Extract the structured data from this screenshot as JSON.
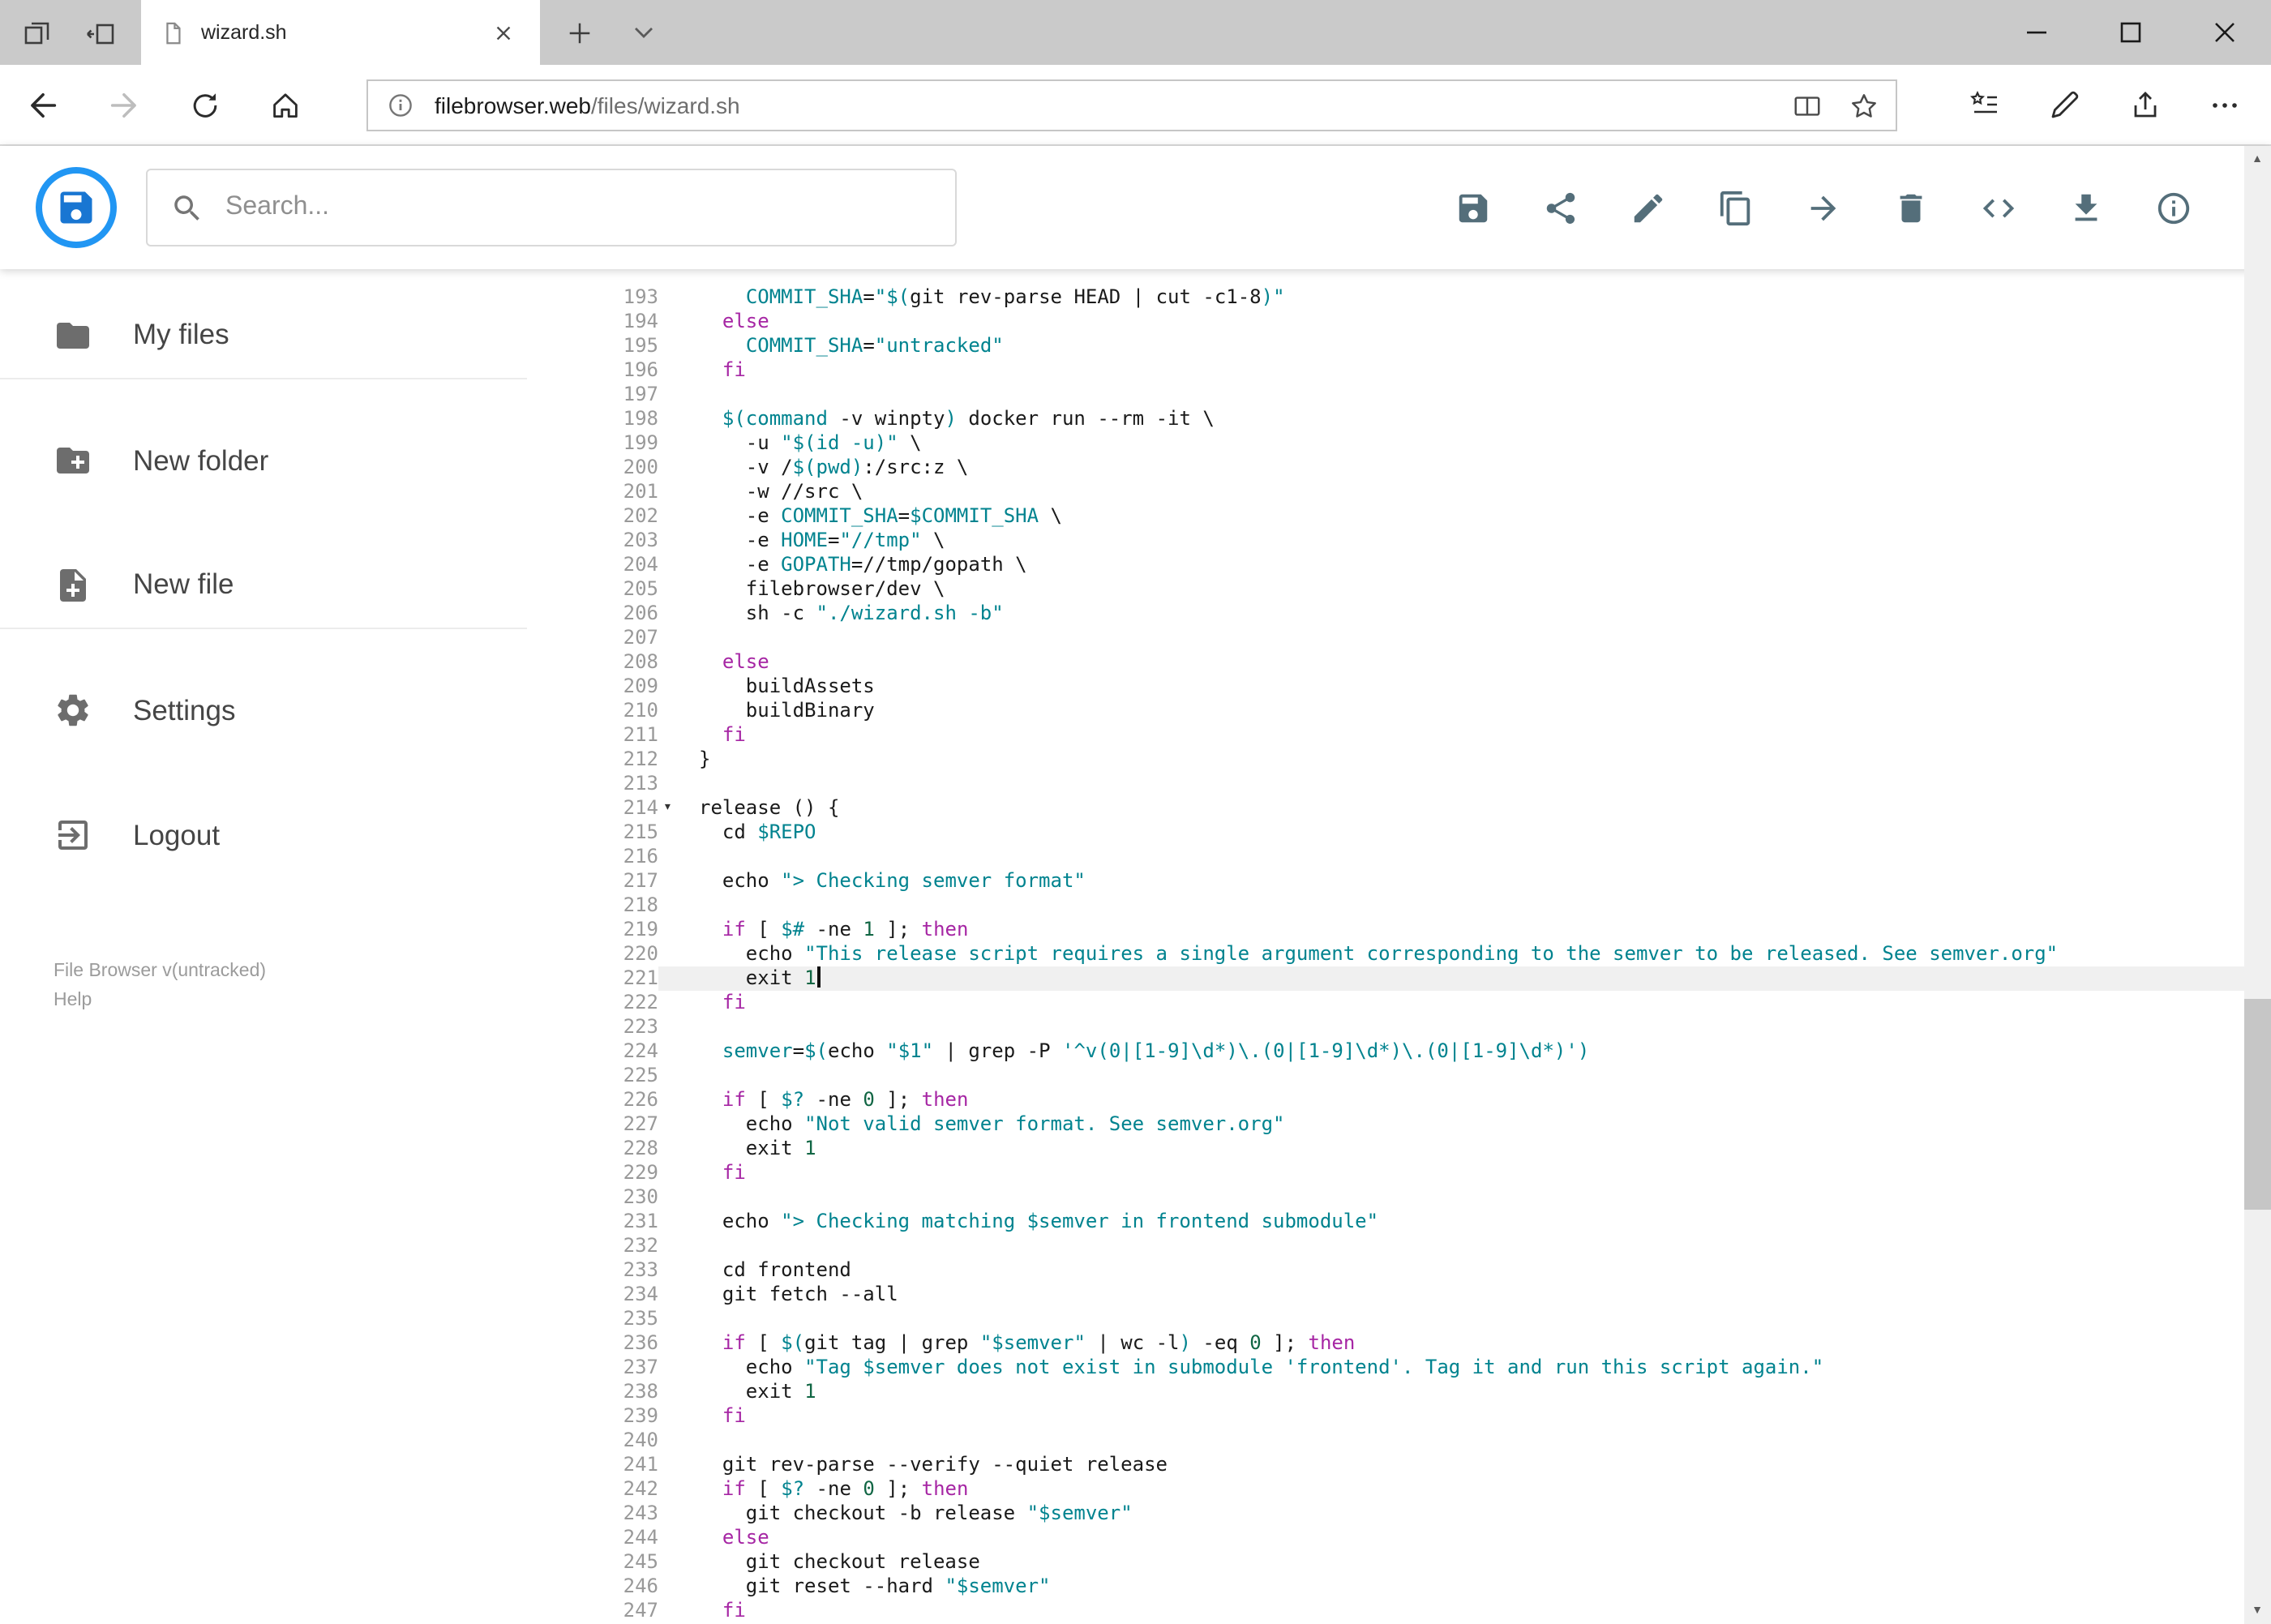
{
  "browser": {
    "tab_title": "wizard.sh",
    "url_domain": "filebrowser.web",
    "url_path": "/files/wizard.sh",
    "tabbar_icons": [
      "tabs-aside-list",
      "set-tabs-aside",
      "new-tab",
      "tab-preview-chevron"
    ],
    "nav_icons": [
      "back",
      "forward",
      "refresh",
      "home"
    ],
    "urlbar_icons": [
      "site-info",
      "reading-view",
      "favorite-star"
    ],
    "toolbar_icons": [
      "hub",
      "web-note",
      "share",
      "more"
    ],
    "window_controls": [
      "minimize",
      "maximize",
      "close"
    ]
  },
  "header": {
    "search_placeholder": "Search...",
    "logo_color": "#2196f3",
    "icon_color": "#546e7a",
    "actions": [
      {
        "id": "save",
        "icon": "save"
      },
      {
        "id": "share",
        "icon": "share"
      },
      {
        "id": "edit",
        "icon": "edit"
      },
      {
        "id": "copy",
        "icon": "copy"
      },
      {
        "id": "move",
        "icon": "move"
      },
      {
        "id": "delete",
        "icon": "delete"
      },
      {
        "id": "code",
        "icon": "code"
      },
      {
        "id": "download",
        "icon": "download"
      },
      {
        "id": "info",
        "icon": "info"
      }
    ]
  },
  "sidebar": {
    "items": [
      {
        "id": "my-files",
        "icon": "folder",
        "label": "My files",
        "divider": true
      },
      {
        "id": "new-folder",
        "icon": "create-new-folder",
        "label": "New folder",
        "divider": false
      },
      {
        "id": "new-file",
        "icon": "new-file",
        "label": "New file",
        "divider": true
      },
      {
        "id": "settings",
        "icon": "settings",
        "label": "Settings",
        "divider": false
      },
      {
        "id": "logout",
        "icon": "logout",
        "label": "Logout",
        "divider": false
      }
    ],
    "footer_version": "File Browser v(untracked)",
    "footer_help": "Help"
  },
  "editor": {
    "syntax_colors": {
      "plain": "#1a1a1a",
      "keyword": "#a626a4",
      "string_var": "#00838f",
      "number": "#116644",
      "line_number": "#999999",
      "active_line_bg": "#f0f0f0"
    },
    "lines": [
      {
        "n": 193,
        "t": [
          [
            "p",
            "    "
          ],
          [
            "t",
            "COMMIT_SHA"
          ],
          [
            "p",
            "="
          ],
          [
            "t",
            "\"$("
          ],
          [
            "p",
            "git rev-parse HEAD | cut -c1-8"
          ],
          [
            "t",
            ")\""
          ]
        ]
      },
      {
        "n": 194,
        "t": [
          [
            "p",
            "  "
          ],
          [
            "k",
            "else"
          ]
        ]
      },
      {
        "n": 195,
        "t": [
          [
            "p",
            "    "
          ],
          [
            "t",
            "COMMIT_SHA"
          ],
          [
            "p",
            "="
          ],
          [
            "t",
            "\"untracked\""
          ]
        ]
      },
      {
        "n": 196,
        "t": [
          [
            "p",
            "  "
          ],
          [
            "k",
            "fi"
          ]
        ]
      },
      {
        "n": 197,
        "t": []
      },
      {
        "n": 198,
        "t": [
          [
            "p",
            "  "
          ],
          [
            "t",
            "$(command"
          ],
          [
            "p",
            " -v winpty"
          ],
          [
            "t",
            ")"
          ],
          [
            "p",
            " docker run --rm -it \\"
          ]
        ]
      },
      {
        "n": 199,
        "t": [
          [
            "p",
            "    -u "
          ],
          [
            "t",
            "\"$(id -u)\""
          ],
          [
            "p",
            " \\"
          ]
        ]
      },
      {
        "n": 200,
        "t": [
          [
            "p",
            "    -v /"
          ],
          [
            "t",
            "$(pwd)"
          ],
          [
            "p",
            ":/src:z \\"
          ]
        ]
      },
      {
        "n": 201,
        "t": [
          [
            "p",
            "    -w //src \\"
          ]
        ]
      },
      {
        "n": 202,
        "t": [
          [
            "p",
            "    -e "
          ],
          [
            "t",
            "COMMIT_SHA"
          ],
          [
            "p",
            "="
          ],
          [
            "t",
            "$COMMIT_SHA"
          ],
          [
            "p",
            " \\"
          ]
        ]
      },
      {
        "n": 203,
        "t": [
          [
            "p",
            "    -e "
          ],
          [
            "t",
            "HOME"
          ],
          [
            "p",
            "="
          ],
          [
            "t",
            "\"//tmp\""
          ],
          [
            "p",
            " \\"
          ]
        ]
      },
      {
        "n": 204,
        "t": [
          [
            "p",
            "    -e "
          ],
          [
            "t",
            "GOPATH"
          ],
          [
            "p",
            "=//tmp/gopath \\"
          ]
        ]
      },
      {
        "n": 205,
        "t": [
          [
            "p",
            "    filebrowser/dev \\"
          ]
        ]
      },
      {
        "n": 206,
        "t": [
          [
            "p",
            "    sh -c "
          ],
          [
            "t",
            "\"./wizard.sh -b\""
          ]
        ]
      },
      {
        "n": 207,
        "t": []
      },
      {
        "n": 208,
        "t": [
          [
            "p",
            "  "
          ],
          [
            "k",
            "else"
          ]
        ]
      },
      {
        "n": 209,
        "t": [
          [
            "p",
            "    buildAssets"
          ]
        ]
      },
      {
        "n": 210,
        "t": [
          [
            "p",
            "    buildBinary"
          ]
        ]
      },
      {
        "n": 211,
        "t": [
          [
            "p",
            "  "
          ],
          [
            "k",
            "fi"
          ]
        ]
      },
      {
        "n": 212,
        "t": [
          [
            "p",
            "}"
          ]
        ]
      },
      {
        "n": 213,
        "t": []
      },
      {
        "n": 214,
        "t": [
          [
            "p",
            "release () {"
          ]
        ],
        "fold": true
      },
      {
        "n": 215,
        "t": [
          [
            "p",
            "  cd "
          ],
          [
            "t",
            "$REPO"
          ]
        ]
      },
      {
        "n": 216,
        "t": []
      },
      {
        "n": 217,
        "t": [
          [
            "p",
            "  echo "
          ],
          [
            "t",
            "\"> Checking semver format\""
          ]
        ]
      },
      {
        "n": 218,
        "t": []
      },
      {
        "n": 219,
        "t": [
          [
            "p",
            "  "
          ],
          [
            "k",
            "if"
          ],
          [
            "p",
            " [ "
          ],
          [
            "t",
            "$#"
          ],
          [
            "p",
            " -ne "
          ],
          [
            "n2",
            "1"
          ],
          [
            "p",
            " ]; "
          ],
          [
            "k",
            "then"
          ]
        ]
      },
      {
        "n": 220,
        "t": [
          [
            "p",
            "    echo "
          ],
          [
            "t",
            "\"This release script requires a single argument corresponding to the semver to be released. See semver.org\""
          ]
        ]
      },
      {
        "n": 221,
        "t": [
          [
            "p",
            "    exit "
          ],
          [
            "n2",
            "1"
          ]
        ],
        "active": true,
        "cursor": true
      },
      {
        "n": 222,
        "t": [
          [
            "p",
            "  "
          ],
          [
            "k",
            "fi"
          ]
        ]
      },
      {
        "n": 223,
        "t": []
      },
      {
        "n": 224,
        "t": [
          [
            "p",
            "  "
          ],
          [
            "t",
            "semver"
          ],
          [
            "p",
            "="
          ],
          [
            "t",
            "$("
          ],
          [
            "p",
            "echo "
          ],
          [
            "t",
            "\"$1\""
          ],
          [
            "p",
            " | grep -P "
          ],
          [
            "t",
            "'^v(0|[1-9]\\d*)\\.(0|[1-9]\\d*)\\.(0|[1-9]\\d*)'"
          ],
          [
            "t",
            ")"
          ]
        ]
      },
      {
        "n": 225,
        "t": []
      },
      {
        "n": 226,
        "t": [
          [
            "p",
            "  "
          ],
          [
            "k",
            "if"
          ],
          [
            "p",
            " [ "
          ],
          [
            "t",
            "$?"
          ],
          [
            "p",
            " -ne "
          ],
          [
            "n2",
            "0"
          ],
          [
            "p",
            " ]; "
          ],
          [
            "k",
            "then"
          ]
        ]
      },
      {
        "n": 227,
        "t": [
          [
            "p",
            "    echo "
          ],
          [
            "t",
            "\"Not valid semver format. See semver.org\""
          ]
        ]
      },
      {
        "n": 228,
        "t": [
          [
            "p",
            "    exit "
          ],
          [
            "n2",
            "1"
          ]
        ]
      },
      {
        "n": 229,
        "t": [
          [
            "p",
            "  "
          ],
          [
            "k",
            "fi"
          ]
        ]
      },
      {
        "n": 230,
        "t": []
      },
      {
        "n": 231,
        "t": [
          [
            "p",
            "  echo "
          ],
          [
            "t",
            "\"> Checking matching $semver in frontend submodule\""
          ]
        ]
      },
      {
        "n": 232,
        "t": []
      },
      {
        "n": 233,
        "t": [
          [
            "p",
            "  cd frontend"
          ]
        ]
      },
      {
        "n": 234,
        "t": [
          [
            "p",
            "  git fetch --all"
          ]
        ]
      },
      {
        "n": 235,
        "t": []
      },
      {
        "n": 236,
        "t": [
          [
            "p",
            "  "
          ],
          [
            "k",
            "if"
          ],
          [
            "p",
            " [ "
          ],
          [
            "t",
            "$("
          ],
          [
            "p",
            "git tag | grep "
          ],
          [
            "t",
            "\"$semver\""
          ],
          [
            "p",
            " | wc -l"
          ],
          [
            "t",
            ")"
          ],
          [
            "p",
            " -eq "
          ],
          [
            "n2",
            "0"
          ],
          [
            "p",
            " ]; "
          ],
          [
            "k",
            "then"
          ]
        ]
      },
      {
        "n": 237,
        "t": [
          [
            "p",
            "    echo "
          ],
          [
            "t",
            "\"Tag $semver does not exist in submodule 'frontend'. Tag it and run this script again.\""
          ]
        ]
      },
      {
        "n": 238,
        "t": [
          [
            "p",
            "    exit "
          ],
          [
            "n2",
            "1"
          ]
        ]
      },
      {
        "n": 239,
        "t": [
          [
            "p",
            "  "
          ],
          [
            "k",
            "fi"
          ]
        ]
      },
      {
        "n": 240,
        "t": []
      },
      {
        "n": 241,
        "t": [
          [
            "p",
            "  git rev-parse --verify --quiet release"
          ]
        ]
      },
      {
        "n": 242,
        "t": [
          [
            "p",
            "  "
          ],
          [
            "k",
            "if"
          ],
          [
            "p",
            " [ "
          ],
          [
            "t",
            "$?"
          ],
          [
            "p",
            " -ne "
          ],
          [
            "n2",
            "0"
          ],
          [
            "p",
            " ]; "
          ],
          [
            "k",
            "then"
          ]
        ]
      },
      {
        "n": 243,
        "t": [
          [
            "p",
            "    git checkout -b release "
          ],
          [
            "t",
            "\"$semver\""
          ]
        ]
      },
      {
        "n": 244,
        "t": [
          [
            "p",
            "  "
          ],
          [
            "k",
            "else"
          ]
        ]
      },
      {
        "n": 245,
        "t": [
          [
            "p",
            "    git checkout release"
          ]
        ]
      },
      {
        "n": 246,
        "t": [
          [
            "p",
            "    git reset --hard "
          ],
          [
            "t",
            "\"$semver\""
          ]
        ]
      },
      {
        "n": 247,
        "t": [
          [
            "p",
            "  "
          ],
          [
            "k",
            "fi"
          ]
        ]
      }
    ]
  }
}
